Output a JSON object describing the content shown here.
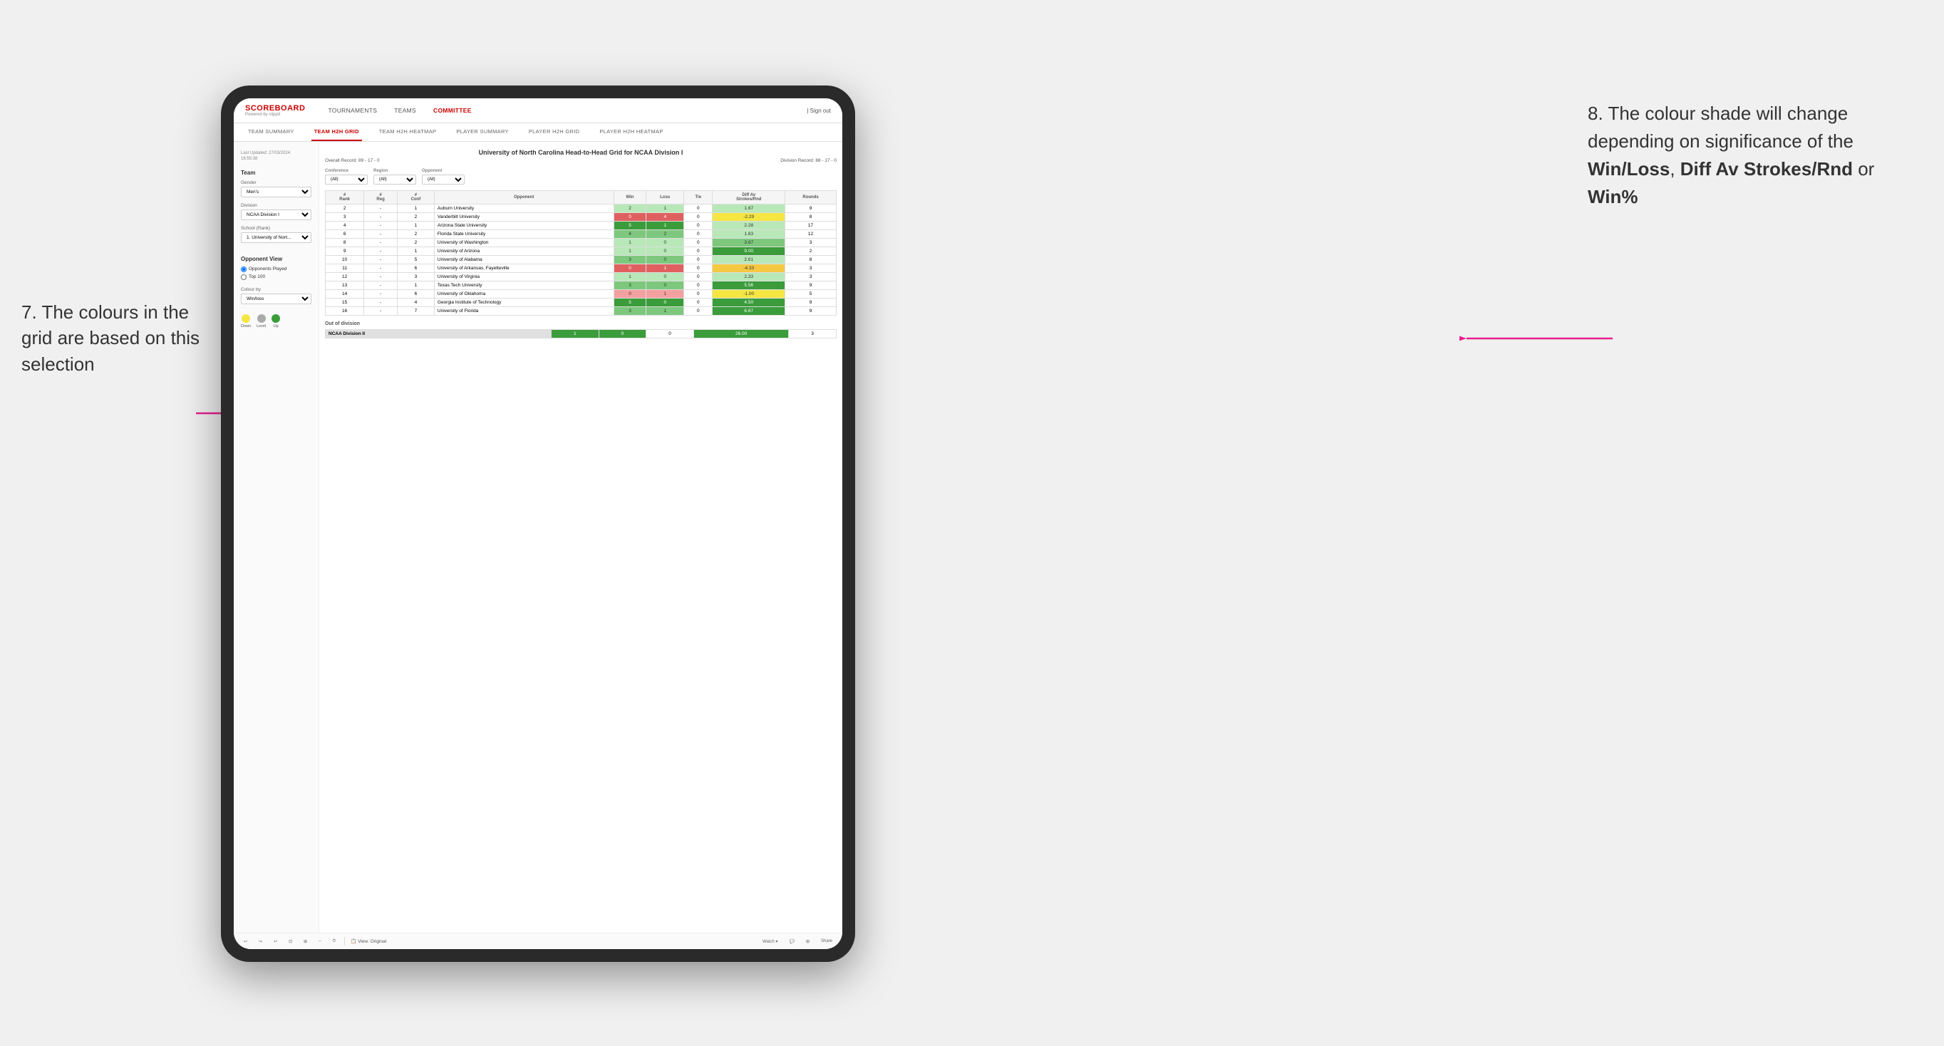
{
  "annotations": {
    "left_number": "7.",
    "left_text": "The colours in the grid are based on this selection",
    "right_number": "8.",
    "right_text": "The colour shade will change depending on significance of the ",
    "right_bold1": "Win/Loss",
    "right_sep1": ", ",
    "right_bold2": "Diff Av Strokes/Rnd",
    "right_sep2": " or ",
    "right_bold3": "Win%"
  },
  "nav": {
    "logo": "SCOREBOARD",
    "logo_sub": "Powered by clippd",
    "items": [
      "TOURNAMENTS",
      "TEAMS",
      "COMMITTEE"
    ],
    "active": "COMMITTEE",
    "sign_out": "Sign out"
  },
  "sub_nav": {
    "items": [
      "TEAM SUMMARY",
      "TEAM H2H GRID",
      "TEAM H2H HEATMAP",
      "PLAYER SUMMARY",
      "PLAYER H2H GRID",
      "PLAYER H2H HEATMAP"
    ],
    "active": "TEAM H2H GRID"
  },
  "sidebar": {
    "last_updated_label": "Last Updated: 27/03/2024",
    "last_updated_time": "16:55:38",
    "team_label": "Team",
    "gender_label": "Gender",
    "gender_value": "Men's",
    "division_label": "Division",
    "division_value": "NCAA Division I",
    "school_label": "School (Rank)",
    "school_value": "1. University of Nort...",
    "opponent_view_label": "Opponent View",
    "radio1": "Opponents Played",
    "radio2": "Top 100",
    "colour_by_label": "Colour by",
    "colour_by_value": "Win/loss",
    "down_label": "Down",
    "level_label": "Level",
    "up_label": "Up"
  },
  "grid": {
    "title": "University of North Carolina Head-to-Head Grid for NCAA Division I",
    "overall_record": "Overall Record: 89 - 17 - 0",
    "division_record": "Division Record: 88 - 17 - 0",
    "conference_label": "Conference",
    "region_label": "Region",
    "opponent_label": "Opponent",
    "opponents_label": "Opponents:",
    "all_label": "(All)",
    "headers": [
      "#\nRank",
      "#\nReg",
      "#\nConf",
      "Opponent",
      "Win",
      "Loss",
      "Tie",
      "Diff Av\nStrokes/Rnd",
      "Rounds"
    ],
    "rows": [
      {
        "rank": "2",
        "reg": "-",
        "conf": "1",
        "opponent": "Auburn University",
        "win": "2",
        "loss": "1",
        "tie": "0",
        "diff": "1.67",
        "rounds": "9",
        "win_color": "green_light",
        "diff_color": "green_light"
      },
      {
        "rank": "3",
        "reg": "-",
        "conf": "2",
        "opponent": "Vanderbilt University",
        "win": "0",
        "loss": "4",
        "tie": "0",
        "diff": "-2.29",
        "rounds": "8",
        "win_color": "red_med",
        "diff_color": "yellow"
      },
      {
        "rank": "4",
        "reg": "-",
        "conf": "1",
        "opponent": "Arizona State University",
        "win": "5",
        "loss": "1",
        "tie": "0",
        "diff": "2.28",
        "rounds": "17",
        "win_color": "green_dark",
        "diff_color": "green_light"
      },
      {
        "rank": "6",
        "reg": "-",
        "conf": "2",
        "opponent": "Florida State University",
        "win": "4",
        "loss": "2",
        "tie": "0",
        "diff": "1.83",
        "rounds": "12",
        "win_color": "green_med",
        "diff_color": "green_light"
      },
      {
        "rank": "8",
        "reg": "-",
        "conf": "2",
        "opponent": "University of Washington",
        "win": "1",
        "loss": "0",
        "tie": "0",
        "diff": "3.67",
        "rounds": "3",
        "win_color": "green_light",
        "diff_color": "green_med"
      },
      {
        "rank": "9",
        "reg": "-",
        "conf": "1",
        "opponent": "University of Arizona",
        "win": "1",
        "loss": "0",
        "tie": "0",
        "diff": "9.00",
        "rounds": "2",
        "win_color": "green_light",
        "diff_color": "green_dark"
      },
      {
        "rank": "10",
        "reg": "-",
        "conf": "5",
        "opponent": "University of Alabama",
        "win": "3",
        "loss": "0",
        "tie": "0",
        "diff": "2.61",
        "rounds": "8",
        "win_color": "green_med",
        "diff_color": "green_light"
      },
      {
        "rank": "11",
        "reg": "-",
        "conf": "6",
        "opponent": "University of Arkansas, Fayetteville",
        "win": "0",
        "loss": "1",
        "tie": "0",
        "diff": "-4.33",
        "rounds": "3",
        "win_color": "red_med",
        "diff_color": "orange_light"
      },
      {
        "rank": "12",
        "reg": "-",
        "conf": "3",
        "opponent": "University of Virginia",
        "win": "1",
        "loss": "0",
        "tie": "0",
        "diff": "2.33",
        "rounds": "3",
        "win_color": "green_light",
        "diff_color": "green_light"
      },
      {
        "rank": "13",
        "reg": "-",
        "conf": "1",
        "opponent": "Texas Tech University",
        "win": "3",
        "loss": "0",
        "tie": "0",
        "diff": "5.56",
        "rounds": "9",
        "win_color": "green_med",
        "diff_color": "green_dark"
      },
      {
        "rank": "14",
        "reg": "-",
        "conf": "6",
        "opponent": "University of Oklahoma",
        "win": "0",
        "loss": "1",
        "tie": "0",
        "diff": "-1.00",
        "rounds": "5",
        "win_color": "red_light",
        "diff_color": "yellow"
      },
      {
        "rank": "15",
        "reg": "-",
        "conf": "4",
        "opponent": "Georgia Institute of Technology",
        "win": "5",
        "loss": "0",
        "tie": "0",
        "diff": "4.50",
        "rounds": "9",
        "win_color": "green_dark",
        "diff_color": "green_dark"
      },
      {
        "rank": "16",
        "reg": "-",
        "conf": "7",
        "opponent": "University of Florida",
        "win": "3",
        "loss": "1",
        "tie": "0",
        "diff": "6.67",
        "rounds": "9",
        "win_color": "green_med",
        "diff_color": "green_dark"
      }
    ],
    "out_of_division_title": "Out of division",
    "out_of_division_rows": [
      {
        "label": "NCAA Division II",
        "win": "1",
        "loss": "0",
        "tie": "0",
        "diff": "26.00",
        "rounds": "3",
        "win_color": "green_dark",
        "diff_color": "green_dark"
      }
    ]
  },
  "toolbar": {
    "view_label": "View: Original",
    "watch_label": "Watch ▾",
    "share_label": "Share"
  },
  "colors": {
    "green_dark": "#3a9c3a",
    "green_med": "#7dc87d",
    "green_light": "#b8e8b8",
    "yellow": "#f5e642",
    "orange_light": "#f5c842",
    "red_light": "#f5a0a0",
    "red_med": "#e06060",
    "pink_arrow": "#e91e8c"
  }
}
